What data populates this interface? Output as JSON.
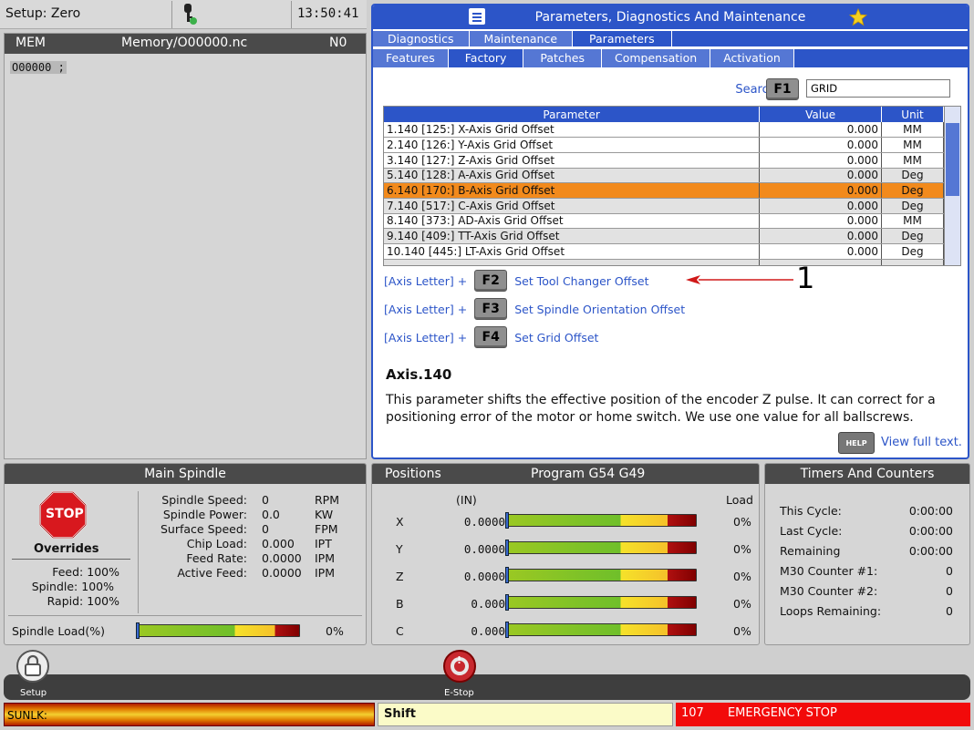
{
  "status_top": {
    "setup": "Setup: Zero",
    "time": "13:50:41"
  },
  "memory": {
    "mode": "MEM",
    "path": "Memory/O00000.nc",
    "line": "N0",
    "code": "O00000 ;"
  },
  "params": {
    "title": "Parameters, Diagnostics And Maintenance",
    "tabs": [
      "Diagnostics",
      "Maintenance",
      "Parameters"
    ],
    "subtabs": [
      "Features",
      "Factory",
      "Patches",
      "Compensation",
      "Activation"
    ],
    "search_label": "Search",
    "search_key": "F1",
    "search_value": "GRID",
    "columns": [
      "Parameter",
      "Value",
      "Unit"
    ],
    "rows": [
      {
        "name": "1.140 [125:] X-Axis Grid Offset",
        "value": "0.000",
        "unit": "MM"
      },
      {
        "name": "2.140 [126:] Y-Axis Grid Offset",
        "value": "0.000",
        "unit": "MM"
      },
      {
        "name": "3.140 [127:] Z-Axis Grid Offset",
        "value": "0.000",
        "unit": "MM"
      },
      {
        "name": "5.140 [128:] A-Axis Grid Offset",
        "value": "0.000",
        "unit": "Deg"
      },
      {
        "name": "6.140 [170:] B-Axis Grid Offset",
        "value": "0.000",
        "unit": "Deg"
      },
      {
        "name": "7.140 [517:] C-Axis Grid Offset",
        "value": "0.000",
        "unit": "Deg"
      },
      {
        "name": "8.140 [373:] AD-Axis Grid Offset",
        "value": "0.000",
        "unit": "MM"
      },
      {
        "name": "9.140 [409:] TT-Axis Grid Offset",
        "value": "0.000",
        "unit": "Deg"
      },
      {
        "name": "10.140 [445:] LT-Axis Grid Offset",
        "value": "0.000",
        "unit": "Deg"
      }
    ],
    "fkeys": [
      {
        "prefix": "[Axis Letter] +",
        "key": "F2",
        "label": "Set Tool Changer Offset"
      },
      {
        "prefix": "[Axis Letter] +",
        "key": "F3",
        "label": "Set Spindle Orientation Offset"
      },
      {
        "prefix": "[Axis Letter] +",
        "key": "F4",
        "label": "Set Grid Offset"
      }
    ],
    "callout": "1",
    "axis_title": "Axis.140",
    "axis_desc": "This parameter shifts the effective position of the encoder Z pulse. It can correct for a positioning error of the motor or home switch. We use one value for all ballscrews.",
    "help": "HELP",
    "view_full": "View full text."
  },
  "spindle": {
    "title": "Main Spindle",
    "stop": "STOP",
    "overrides_label": "Overrides",
    "overrides": [
      {
        "label": "Feed:",
        "value": "100%"
      },
      {
        "label": "Spindle:",
        "value": "100%"
      },
      {
        "label": "Rapid:",
        "value": "100%"
      }
    ],
    "stats": [
      {
        "label": "Spindle Speed:",
        "value": "0",
        "unit": "RPM"
      },
      {
        "label": "Spindle Power:",
        "value": "0.0",
        "unit": "KW"
      },
      {
        "label": "Surface Speed:",
        "value": "0",
        "unit": "FPM"
      },
      {
        "label": "Chip Load:",
        "value": "0.000",
        "unit": "IPT"
      },
      {
        "label": "Feed Rate:",
        "value": "0.0000",
        "unit": "IPM"
      },
      {
        "label": "Active Feed:",
        "value": "0.0000",
        "unit": "IPM"
      }
    ],
    "load_label": "Spindle Load(%)",
    "load_value": "0%"
  },
  "positions": {
    "title": "Positions",
    "program": "Program G54 G49",
    "unit": "(IN)",
    "load_label": "Load",
    "axes": [
      {
        "axis": "X",
        "value": "0.0000",
        "load": "0%"
      },
      {
        "axis": "Y",
        "value": "0.0000",
        "load": "0%"
      },
      {
        "axis": "Z",
        "value": "0.0000",
        "load": "0%"
      },
      {
        "axis": "B",
        "value": "0.000",
        "load": "0%"
      },
      {
        "axis": "C",
        "value": "0.000",
        "load": "0%"
      }
    ]
  },
  "timers": {
    "title": "Timers And Counters",
    "items": [
      {
        "label": "This Cycle:",
        "value": "0:00:00"
      },
      {
        "label": "Last Cycle:",
        "value": "0:00:00"
      },
      {
        "label": "Remaining",
        "value": "0:00:00"
      },
      {
        "label": "M30 Counter #1:",
        "value": "0"
      },
      {
        "label": "M30 Counter #2:",
        "value": "0"
      },
      {
        "label": "Loops Remaining:",
        "value": "0"
      }
    ]
  },
  "bottom": {
    "setup": "Setup",
    "estop": "E-Stop"
  },
  "statusbar": {
    "left": "SUNLK:",
    "mid": "Shift",
    "code": "107",
    "message": "EMERGENCY STOP"
  },
  "icons": [
    "key-icon",
    "lock-icon",
    "estop-icon",
    "star-icon",
    "menu-icon",
    "stop-sign-icon"
  ],
  "colors": {
    "accent": "#2c55c8",
    "highlight_row": "#f28a1c",
    "alarm": "#f20a0a"
  }
}
